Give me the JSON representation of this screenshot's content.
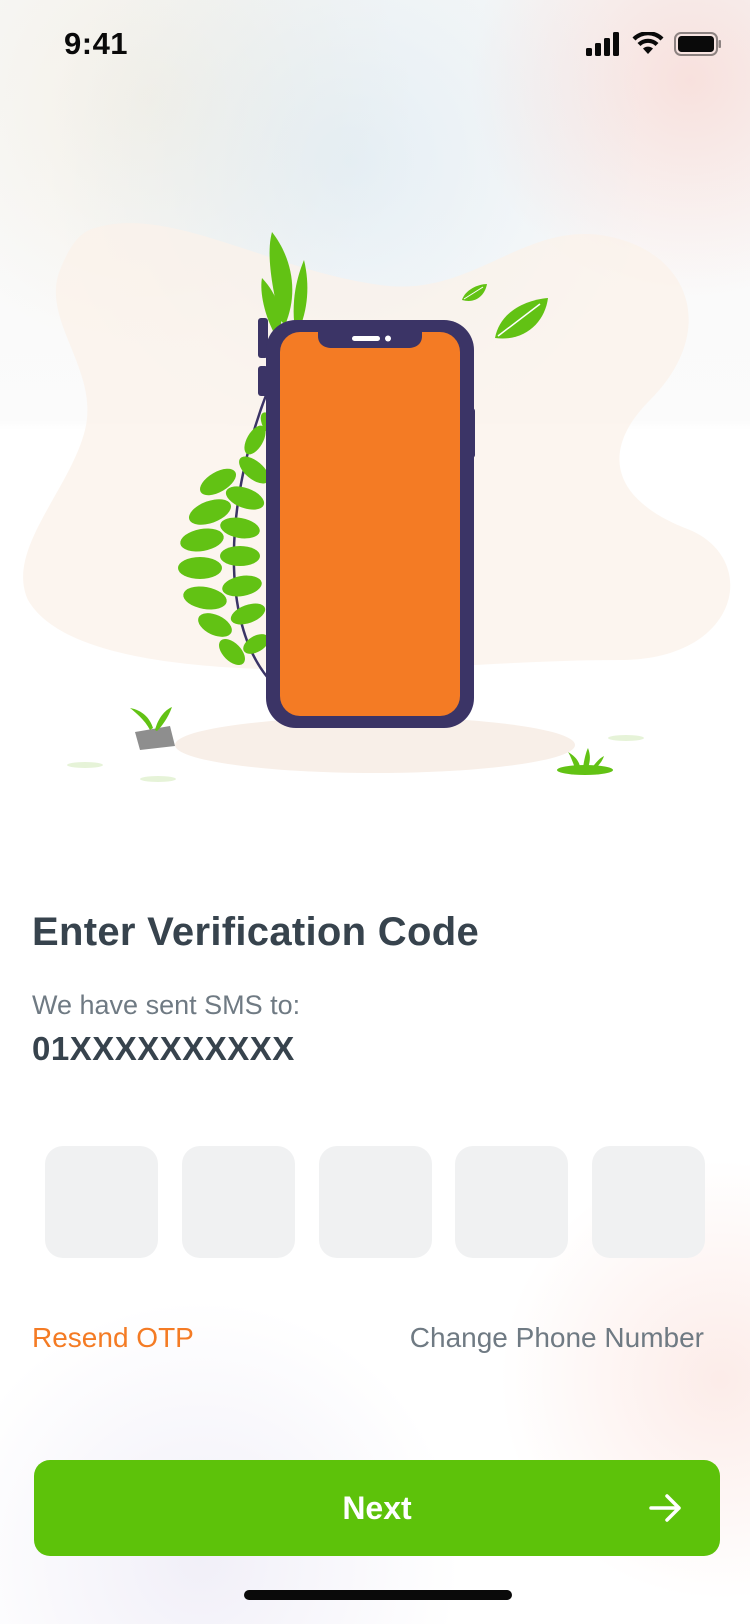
{
  "status_bar": {
    "time": "9:41",
    "icons": [
      "cellular-signal-icon",
      "wifi-icon",
      "battery-icon"
    ]
  },
  "illustration": {
    "icons": [
      "smartphone-illustration",
      "fern-leaves-icon",
      "falling-leaf-icon",
      "sprout-on-rock-icon",
      "grass-tuft-icon"
    ]
  },
  "verification": {
    "title": "Enter Verification Code",
    "subtitle": "We have sent SMS to:",
    "phone_number": "01XXXXXXXXXX",
    "otp_digits": [
      "",
      "",
      "",
      "",
      ""
    ]
  },
  "links": {
    "resend": "Resend OTP",
    "change_phone": "Change Phone Number"
  },
  "next_button": {
    "label": "Next",
    "icon": "arrow-right-icon"
  },
  "colors": {
    "accent_orange": "#f47b24",
    "primary_green": "#5dc20a",
    "phone_frame": "#3b3466",
    "leaf_green": "#62c214",
    "otp_box_bg": "#f0f1f2",
    "text_dark": "#37434d",
    "text_muted": "#6f7a83"
  }
}
